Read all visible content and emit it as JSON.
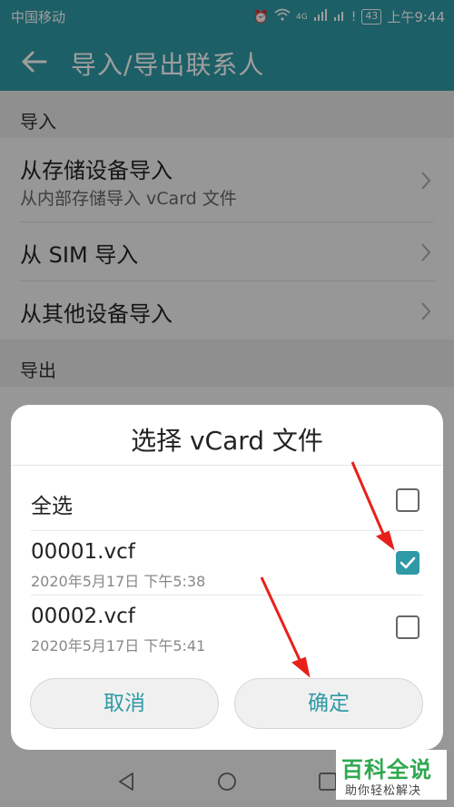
{
  "status_bar": {
    "carrier": "中国移动",
    "network": "4G",
    "battery": "43",
    "time": "上午9:44"
  },
  "app_bar": {
    "title": "导入/导出联系人"
  },
  "import_section": {
    "header": "导入",
    "items": [
      {
        "label": "从存储设备导入",
        "sublabel": "从内部存储导入 vCard 文件"
      },
      {
        "label": "从 SIM 导入"
      },
      {
        "label": "从其他设备导入"
      }
    ]
  },
  "export_section": {
    "header": "导出"
  },
  "dialog": {
    "title": "选择 vCard 文件",
    "select_all": {
      "label": "全选",
      "checked": false
    },
    "files": [
      {
        "name": "00001.vcf",
        "date": "2020年5月17日 下午5:38",
        "checked": true
      },
      {
        "name": "00002.vcf",
        "date": "2020年5月17日 下午5:41",
        "checked": false
      }
    ],
    "cancel_label": "取消",
    "ok_label": "确定"
  },
  "watermark": {
    "title": "百科全说",
    "subtitle": "助你轻松解决"
  },
  "colors": {
    "accent": "#2f9aa6",
    "annotation_arrow": "#e8201b",
    "watermark_green": "#2fa84f"
  }
}
